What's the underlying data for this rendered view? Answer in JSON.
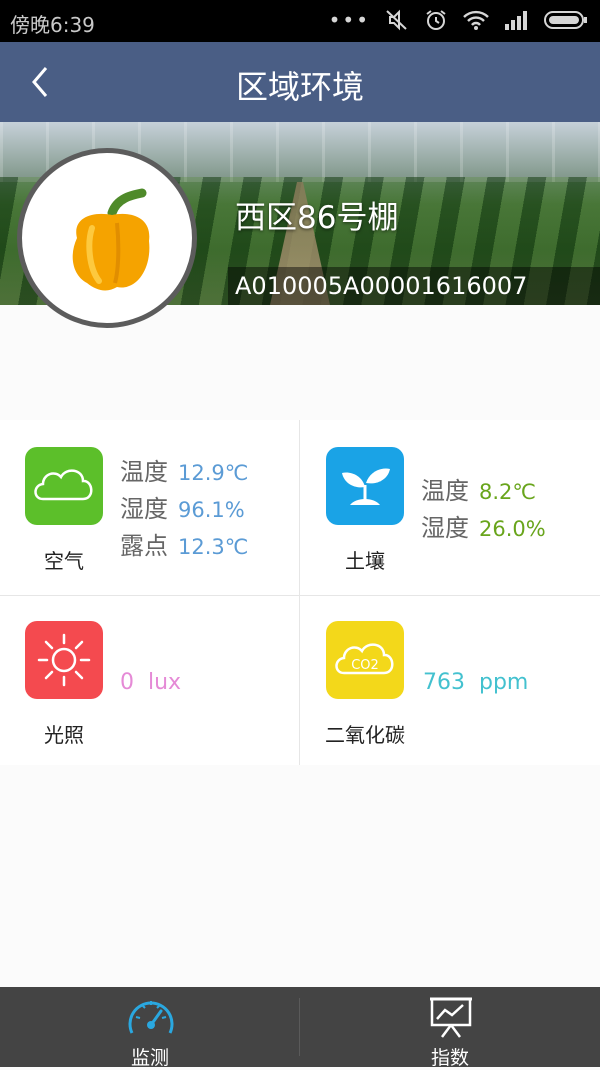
{
  "status_bar": {
    "time": "傍晚6:39",
    "more_dots": "•••"
  },
  "header": {
    "title": "区域环境",
    "back_icon": "chevron-left-icon"
  },
  "greenhouse": {
    "name": "西区86号棚",
    "code": "A010005A00001616007",
    "crop_icon": "bell-pepper-icon"
  },
  "sensors": {
    "air": {
      "label": "空气",
      "icon": "cloud-icon",
      "color": "#5cbf2a",
      "readings": [
        {
          "name": "温度",
          "value": "12.9℃"
        },
        {
          "name": "湿度",
          "value": "96.1%"
        },
        {
          "name": "露点",
          "value": "12.3℃"
        }
      ]
    },
    "soil": {
      "label": "土壤",
      "icon": "sprout-icon",
      "color": "#1aa3e6",
      "readings": [
        {
          "name": "温度",
          "value": "8.2℃"
        },
        {
          "name": "湿度",
          "value": "26.0%"
        }
      ]
    },
    "light": {
      "label": "光照",
      "icon": "sun-icon",
      "color": "#f44a4f",
      "value": "0",
      "unit": "lux",
      "value_color": "#e58ad6"
    },
    "co2": {
      "label": "二氧化碳",
      "icon": "co2-cloud-icon",
      "color": "#f3d81a",
      "value": "763",
      "unit": "ppm",
      "value_color": "#43c1cf",
      "icon_text": "CO2"
    }
  },
  "tabbar": {
    "tabs": [
      {
        "label": "监测",
        "icon": "gauge-icon"
      },
      {
        "label": "指数",
        "icon": "chart-board-icon"
      }
    ]
  }
}
